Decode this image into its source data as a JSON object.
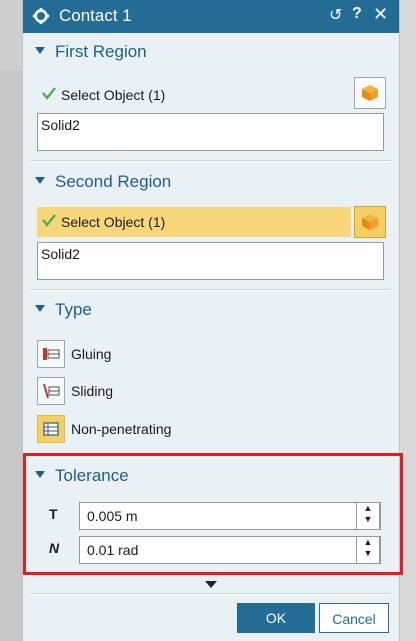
{
  "dialog": {
    "title": "Contact 1",
    "reset_glyph": "↺",
    "help_glyph": "?",
    "close_glyph": "✕"
  },
  "first_region": {
    "header": "First Region",
    "select_label": "Select Object (1)",
    "value": "Solid2"
  },
  "second_region": {
    "header": "Second Region",
    "select_label": "Select Object (1)",
    "value": "Solid2"
  },
  "type": {
    "header": "Type",
    "options": [
      {
        "label": "Gluing",
        "selected": false
      },
      {
        "label": "Sliding",
        "selected": false
      },
      {
        "label": "Non-penetrating",
        "selected": true
      }
    ]
  },
  "tolerance": {
    "header": "Tolerance",
    "distance_symbol": "T",
    "distance_value": "0.005 m",
    "angle_symbol": "N",
    "angle_value": "0.01 rad"
  },
  "footer": {
    "ok_label": "OK",
    "cancel_label": "Cancel"
  },
  "colors": {
    "title_bar": "#236c96",
    "accent_text": "#1d5f86",
    "active_row": "#f7d77a",
    "highlight_border": "#e41d1d"
  }
}
